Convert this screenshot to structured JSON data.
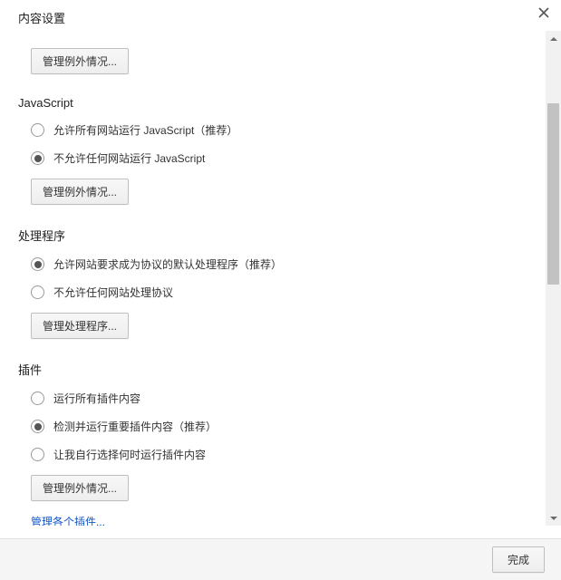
{
  "title": "内容设置",
  "top_button": "管理例外情况...",
  "sections": {
    "javascript": {
      "title": "JavaScript",
      "opt_allow": "允许所有网站运行 JavaScript（推荐）",
      "opt_block": "不允许任何网站运行 JavaScript",
      "btn": "管理例外情况..."
    },
    "handlers": {
      "title": "处理程序",
      "opt_allow": "允许网站要求成为协议的默认处理程序（推荐）",
      "opt_block": "不允许任何网站处理协议",
      "btn": "管理处理程序..."
    },
    "plugins": {
      "title": "插件",
      "opt_all": "运行所有插件内容",
      "opt_detect": "检测并运行重要插件内容（推荐）",
      "opt_choose": "让我自行选择何时运行插件内容",
      "btn": "管理例外情况...",
      "link": "管理各个插件..."
    }
  },
  "footer": {
    "done": "完成"
  }
}
